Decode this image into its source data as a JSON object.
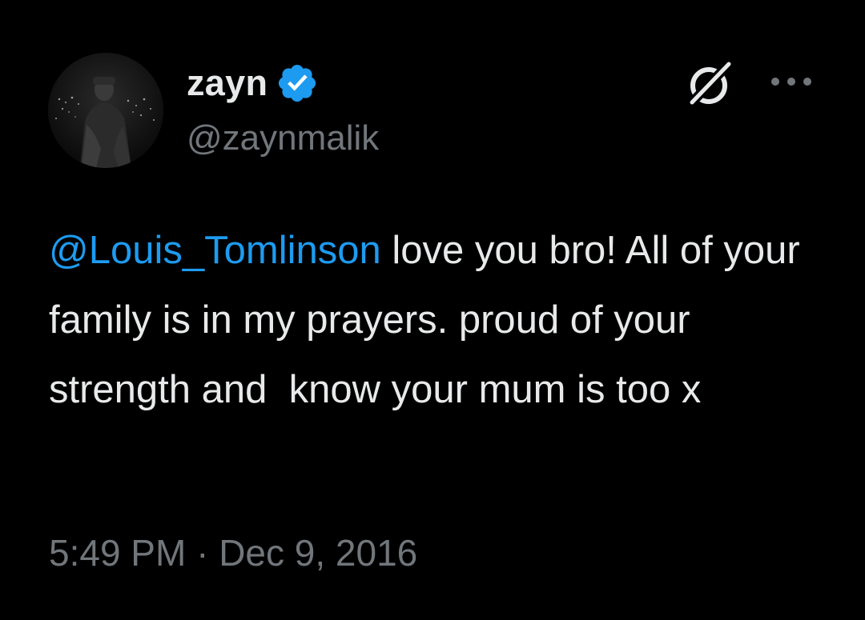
{
  "author": {
    "display_name": "zayn",
    "handle": "@zaynmalik",
    "verified": true,
    "verified_color": "#1d9bf0"
  },
  "header_icons": {
    "grok": "grok-icon",
    "more": "more-options-icon"
  },
  "tweet": {
    "mention": "@Louis_Tomlinson",
    "text_after_mention": " love you bro! All of your family is in my prayers. proud of your strength and  know your mum is too x",
    "mention_color": "#1d9bf0"
  },
  "meta": {
    "time": "5:49 PM",
    "separator": " · ",
    "date": "Dec 9, 2016"
  },
  "colors": {
    "background": "#000000",
    "text_primary": "#e7e9ea",
    "text_secondary": "#71767b"
  }
}
